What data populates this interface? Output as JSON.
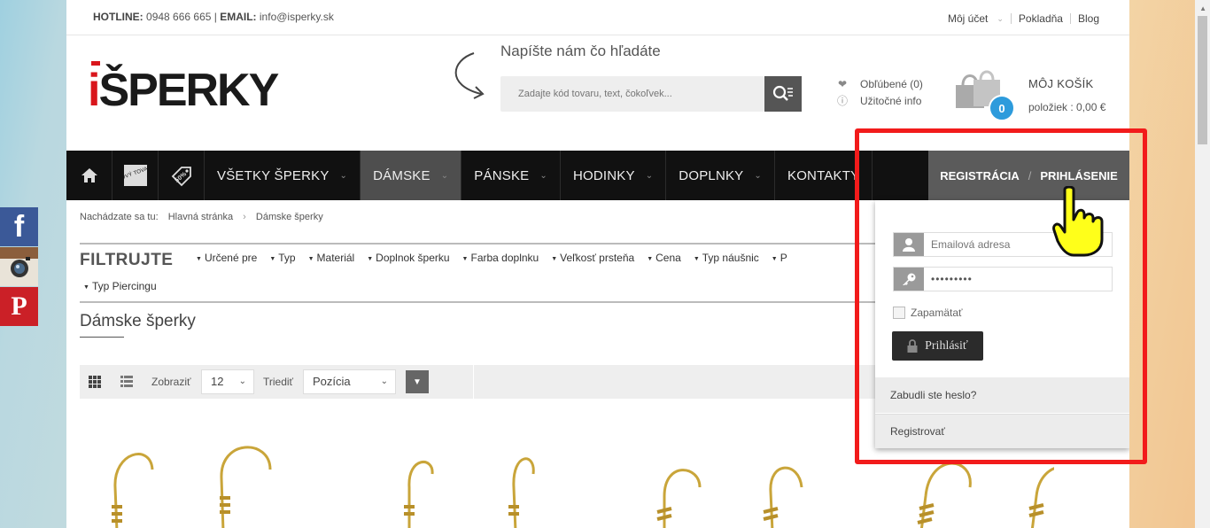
{
  "topbar": {
    "hotline_label": "HOTLINE:",
    "hotline_number": "0948 666 665 |",
    "email_label": "EMAIL:",
    "email": "info@isperky.sk",
    "account": "Môj účet",
    "checkout": "Pokladňa",
    "blog": "Blog"
  },
  "logo": {
    "first": "i",
    "rest": "ŠPERKY"
  },
  "search": {
    "hint": "Napíšte nám čo hľadáte",
    "placeholder": "Zadajte kód tovaru, text, čokoľvek..."
  },
  "wishlist": {
    "favorites": "Obľúbené (0)",
    "info": "Užitočné info"
  },
  "cart": {
    "count": "0",
    "title": "MÔJ KOŠÍK",
    "summary": "položiek : 0,00 €"
  },
  "nav": {
    "items": [
      {
        "label": "VŠETKY ŠPERKY",
        "chevron": true
      },
      {
        "label": "DÁMSKE",
        "chevron": true,
        "active": true
      },
      {
        "label": "PÁNSKE",
        "chevron": true
      },
      {
        "label": "HODINKY",
        "chevron": true
      },
      {
        "label": "DOPLNKY",
        "chevron": true
      },
      {
        "label": "KONTAKTY",
        "chevron": false
      }
    ],
    "new_badge": "NOVÝ TOVAR",
    "sale_badge": "50%",
    "register": "REGISTRÁCIA",
    "login": "PRIHLÁSENIE"
  },
  "breadcrumb": {
    "prefix": "Nachádzate sa tu:",
    "home": "Hlavná stránka",
    "current": "Dámske šperky"
  },
  "filter": {
    "title": "FILTRUJTE",
    "items": [
      "Určené pre",
      "Typ",
      "Materiál",
      "Doplnok šperku",
      "Farba doplnku",
      "Veľkosť prsteňa",
      "Cena",
      "Typ náušnic",
      "P"
    ],
    "row2": "Typ Piercingu"
  },
  "category": {
    "title": "Dámske šperky"
  },
  "toolbar": {
    "show_label": "Zobraziť",
    "show_value": "12",
    "sort_label": "Triediť",
    "sort_value": "Pozícia"
  },
  "login": {
    "email_placeholder": "Emailová adresa",
    "password_value": "•••••••••",
    "remember": "Zapamätať",
    "button": "Prihlásiť",
    "forgot": "Zabudli ste heslo?",
    "register": "Registrovať"
  },
  "social": {
    "facebook": "f",
    "pinterest": "P"
  },
  "colors": {
    "accent_blue": "#2d9bdc",
    "nav_bg": "#111111",
    "logo_red": "#d9161c",
    "highlight_red": "#f21b1b"
  }
}
